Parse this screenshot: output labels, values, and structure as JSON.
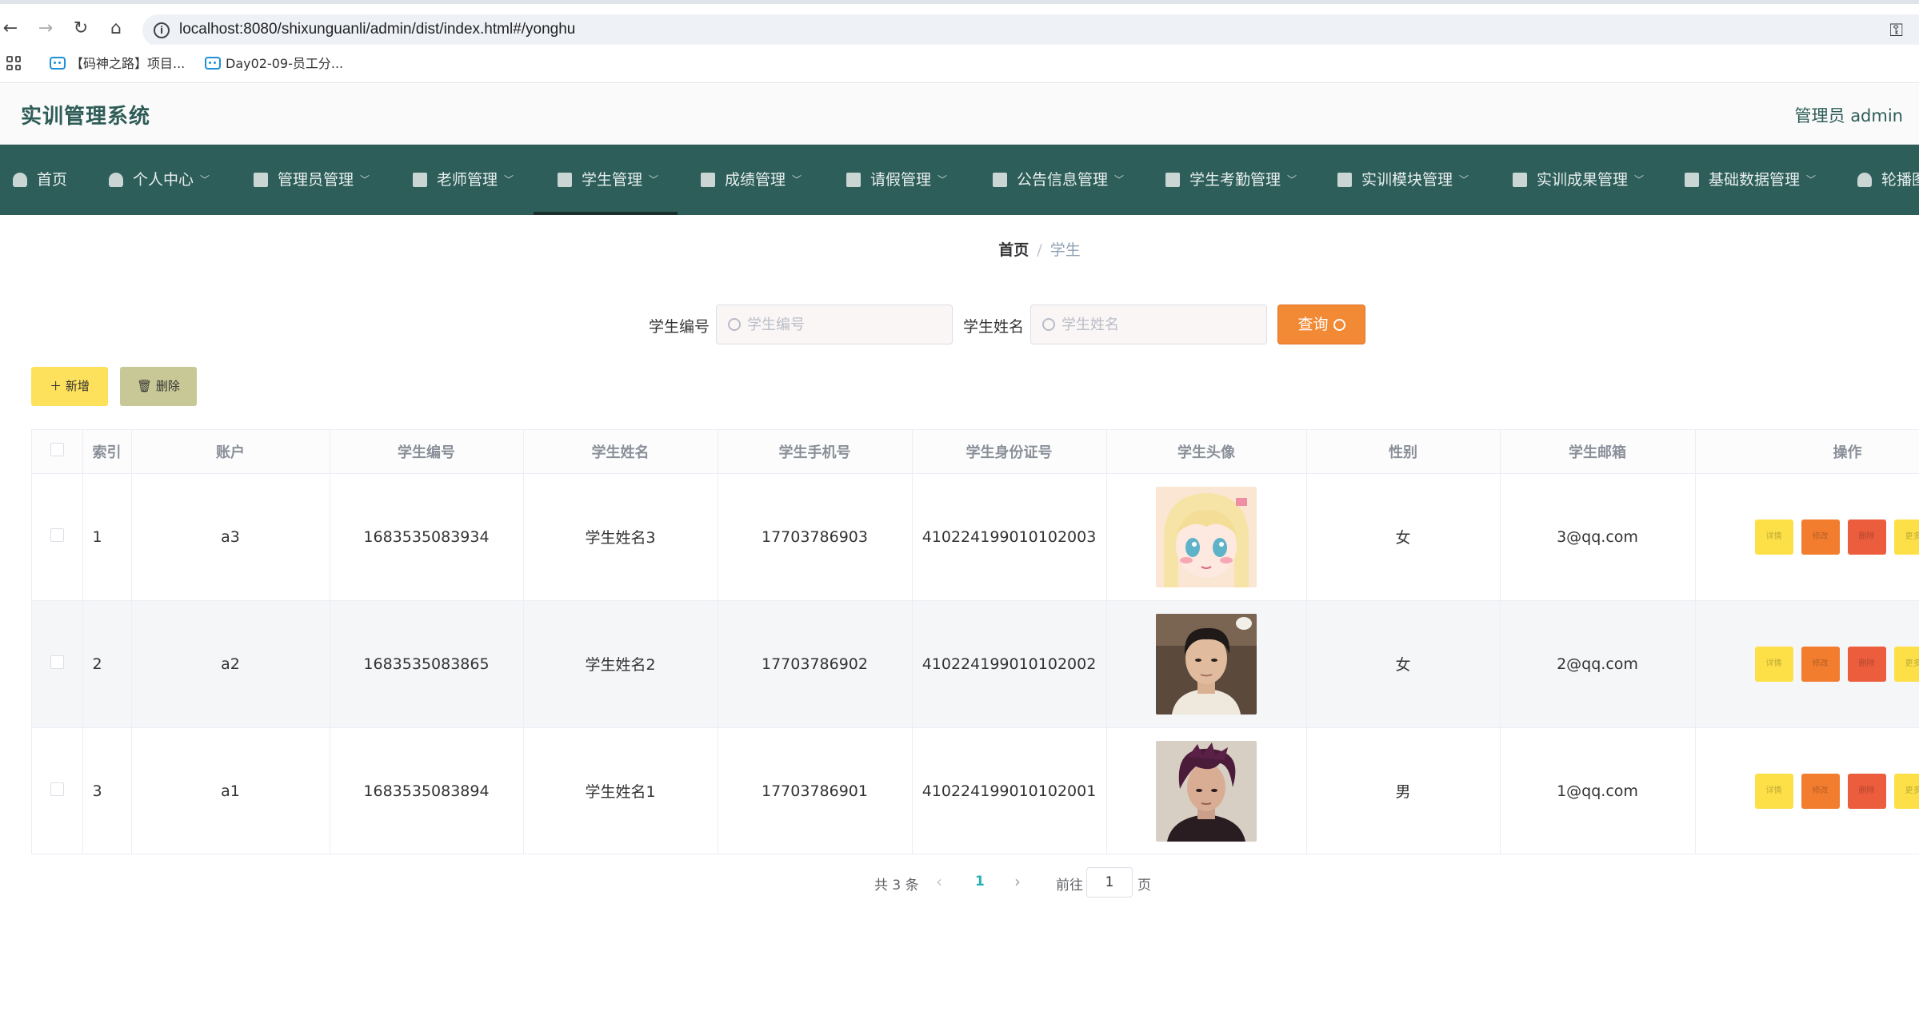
{
  "browser": {
    "url": "localhost:8080/shixunguanli/admin/dist/index.html#/yonghu",
    "bookmarks": [
      "【码神之路】项目...",
      "Day02-09-员工分..."
    ]
  },
  "header": {
    "title": "实训管理系统",
    "user": "管理员 admin"
  },
  "menu": [
    {
      "label": "首页",
      "icon": "home-icon"
    },
    {
      "label": "个人中心",
      "icon": "user-icon"
    },
    {
      "label": "管理员管理",
      "icon": "briefcase-icon"
    },
    {
      "label": "老师管理",
      "icon": "clipboard-icon"
    },
    {
      "label": "学生管理",
      "icon": "copy-icon"
    },
    {
      "label": "成绩管理",
      "icon": "ticket-icon"
    },
    {
      "label": "请假管理",
      "icon": "present-icon"
    },
    {
      "label": "公告信息管理",
      "icon": "mic-icon"
    },
    {
      "label": "学生考勤管理",
      "icon": "bell-off-icon"
    },
    {
      "label": "实训模块管理",
      "icon": "list-icon"
    },
    {
      "label": "实训成果管理",
      "icon": "flag-icon"
    },
    {
      "label": "基础数据管理",
      "icon": "sliders-icon"
    },
    {
      "label": "轮播图",
      "icon": "user-icon"
    }
  ],
  "breadcrumb": {
    "home": "首页",
    "sep": "/",
    "current": "学生"
  },
  "search": {
    "label_no": "学生编号",
    "placeholder_no": "学生编号",
    "label_name": "学生姓名",
    "placeholder_name": "学生姓名",
    "query_label": "查询"
  },
  "actions": {
    "add_label": "新增",
    "delete_label": "删除"
  },
  "table": {
    "columns": [
      "索引",
      "账户",
      "学生编号",
      "学生姓名",
      "学生手机号",
      "学生身份证号",
      "学生头像",
      "性别",
      "学生邮箱",
      "操作"
    ],
    "rows": [
      {
        "index": "1",
        "account": "a3",
        "no": "1683535083934",
        "name": "学生姓名3",
        "phone": "17703786903",
        "idcard": "410224199010102003",
        "avatar": "anime-girl",
        "gender": "女",
        "email": "3@qq.com"
      },
      {
        "index": "2",
        "account": "a2",
        "no": "1683535083865",
        "name": "学生姓名2",
        "phone": "17703786902",
        "idcard": "410224199010102002",
        "avatar": "young-man",
        "gender": "女",
        "email": "2@qq.com"
      },
      {
        "index": "3",
        "account": "a1",
        "no": "1683535083894",
        "name": "学生姓名1",
        "phone": "17703786901",
        "idcard": "410224199010102001",
        "avatar": "dark-hair-man",
        "gender": "男",
        "email": "1@qq.com"
      }
    ],
    "op_buttons": [
      "详情",
      "修改",
      "删除",
      "更多"
    ]
  },
  "pagination": {
    "total": "共 3 条",
    "current": "1",
    "goto": "前往",
    "goto_value": "1",
    "page": "页"
  },
  "colors": {
    "primary": "#2d5e5a",
    "accent": "#f28a35",
    "add": "#fde05b",
    "delete": "#c8c897"
  }
}
